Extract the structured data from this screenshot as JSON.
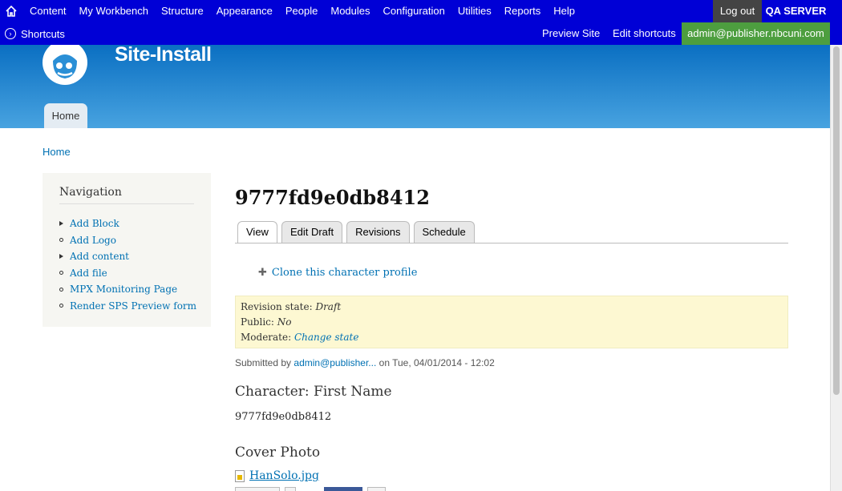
{
  "toolbar": {
    "menu": [
      "Content",
      "My Workbench",
      "Structure",
      "Appearance",
      "People",
      "Modules",
      "Configuration",
      "Utilities",
      "Reports",
      "Help"
    ],
    "logout": "Log out",
    "server": "QA SERVER",
    "shortcuts": "Shortcuts",
    "preview_site": "Preview Site",
    "edit_shortcuts": "Edit shortcuts",
    "user": "admin@publisher.nbcuni.com"
  },
  "header": {
    "site_name": "Site-Install",
    "home_tab": "Home"
  },
  "breadcrumb": "Home",
  "sidebar": {
    "title": "Navigation",
    "items": [
      {
        "label": "Add Block",
        "bullet": "triangle"
      },
      {
        "label": "Add Logo",
        "bullet": "circle"
      },
      {
        "label": "Add content",
        "bullet": "triangle"
      },
      {
        "label": "Add file",
        "bullet": "circle"
      },
      {
        "label": "MPX Monitoring Page",
        "bullet": "circle"
      },
      {
        "label": "Render SPS Preview form",
        "bullet": "circle"
      }
    ]
  },
  "node": {
    "title": "9777fd9e0db8412",
    "tabs": [
      "View",
      "Edit Draft",
      "Revisions",
      "Schedule"
    ],
    "active_tab": "View",
    "clone_link": "Clone this character profile",
    "revision": {
      "state_label": "Revision state:",
      "state_value": "Draft",
      "public_label": "Public:",
      "public_value": "No",
      "moderate_label": "Moderate:",
      "moderate_value": "Change state"
    },
    "submitted": {
      "prefix": "Submitted by",
      "author": "admin@publisher...",
      "suffix": "on Tue, 04/01/2014 - 12:02"
    },
    "fields": {
      "character_label": "Character: First Name",
      "character_value": "9777fd9e0db8412",
      "cover_label": "Cover Photo",
      "file_name": "HanSolo.jpg"
    }
  },
  "colors": {
    "toolbar": "#0000d6",
    "user_box": "#4d9e3f",
    "link": "#0071b3",
    "revision_bg": "#fdf8d2"
  }
}
